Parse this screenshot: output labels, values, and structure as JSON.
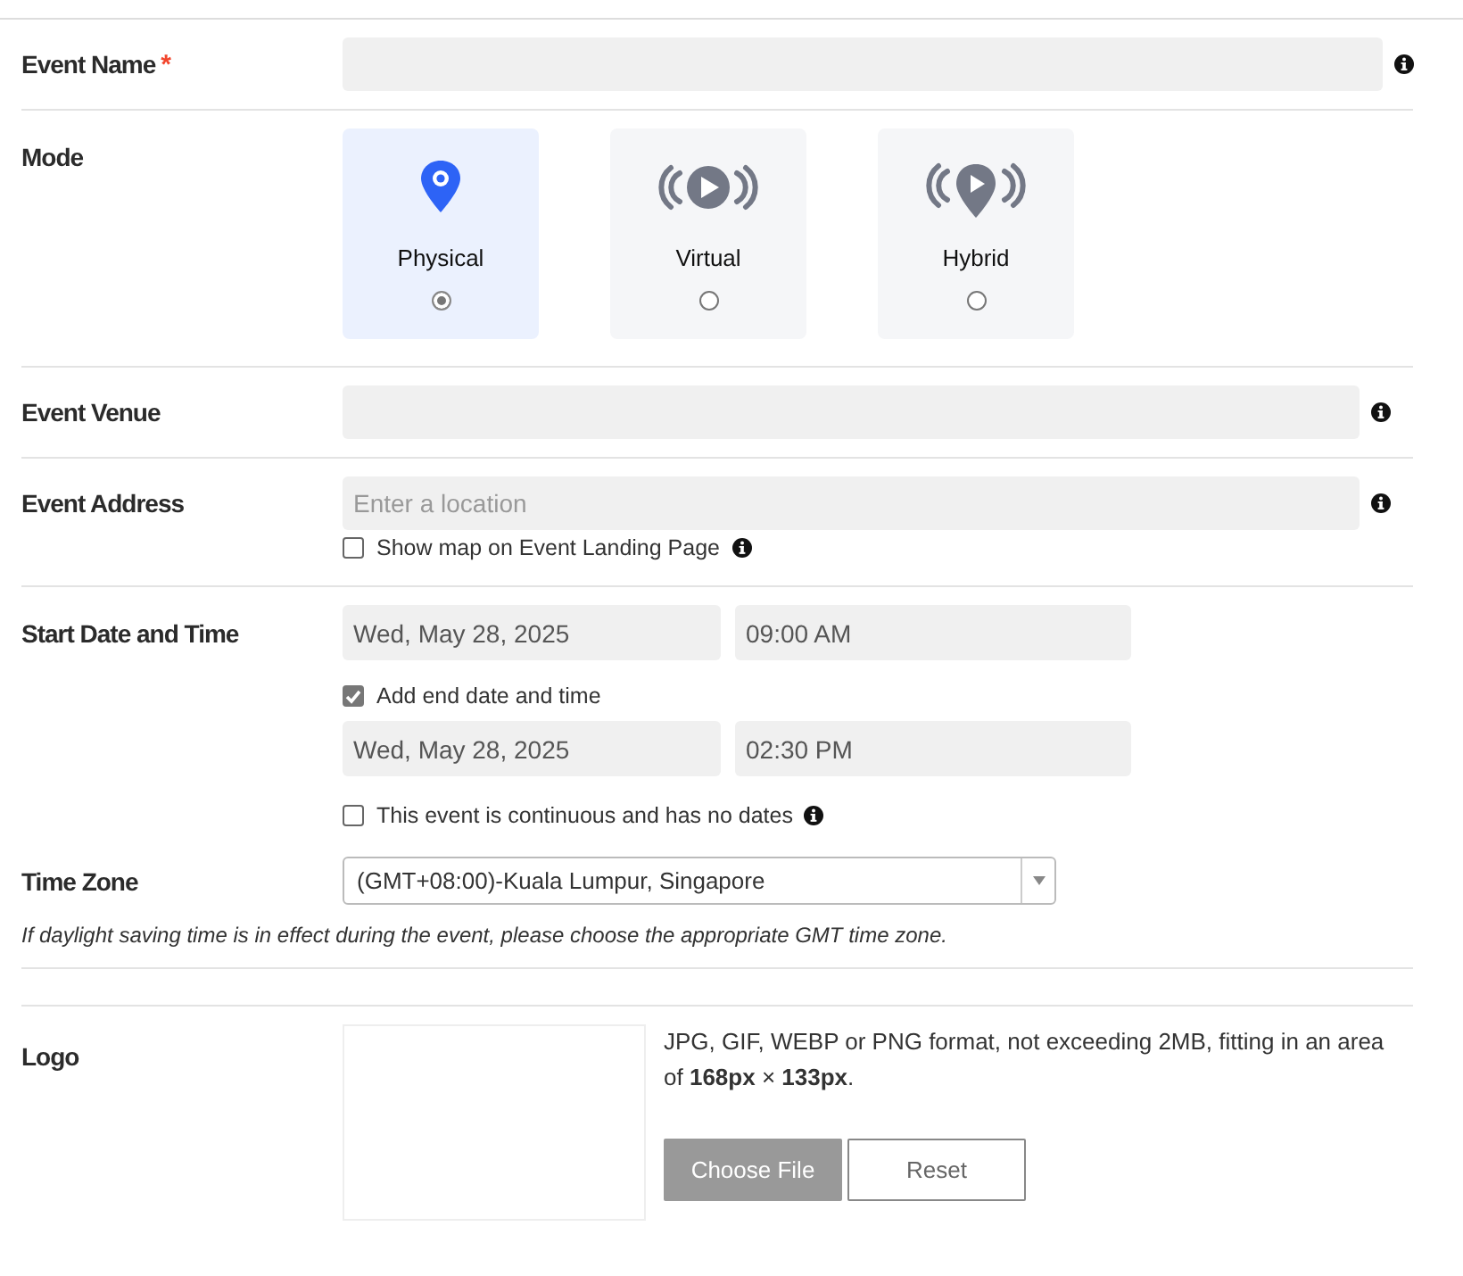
{
  "event_name": {
    "label": "Event Name",
    "required_mark": "*"
  },
  "mode": {
    "label": "Mode",
    "options": [
      {
        "label": "Physical",
        "kind": "pin",
        "selected": true
      },
      {
        "label": "Virtual",
        "kind": "broadcast",
        "selected": false
      },
      {
        "label": "Hybrid",
        "kind": "broadcast-pin",
        "selected": false
      }
    ]
  },
  "event_venue": {
    "label": "Event Venue"
  },
  "event_address": {
    "label": "Event Address",
    "placeholder": "Enter a location",
    "show_map": {
      "label": "Show map on Event Landing Page",
      "checked": false
    }
  },
  "start": {
    "label": "Start Date and Time",
    "start_date": "Wed, May 28, 2025",
    "start_time": "09:00 AM",
    "add_end": {
      "label": "Add end date and time",
      "checked": true
    },
    "end_date": "Wed, May 28, 2025",
    "end_time": "02:30 PM",
    "continuous": {
      "label": "This event is continuous and has no dates",
      "checked": false
    }
  },
  "time_zone": {
    "label": "Time Zone",
    "value": "(GMT+08:00)-Kuala Lumpur, Singapore",
    "note": "If daylight saving time is in effect during the event, please choose the appropriate GMT time zone."
  },
  "logo": {
    "label": "Logo",
    "hint": "JPG, GIF, WEBP or PNG format, not exceeding 2MB, fitting in an area of **168px** × **133px**.",
    "buttons": [
      "Choose File",
      "Reset"
    ]
  }
}
